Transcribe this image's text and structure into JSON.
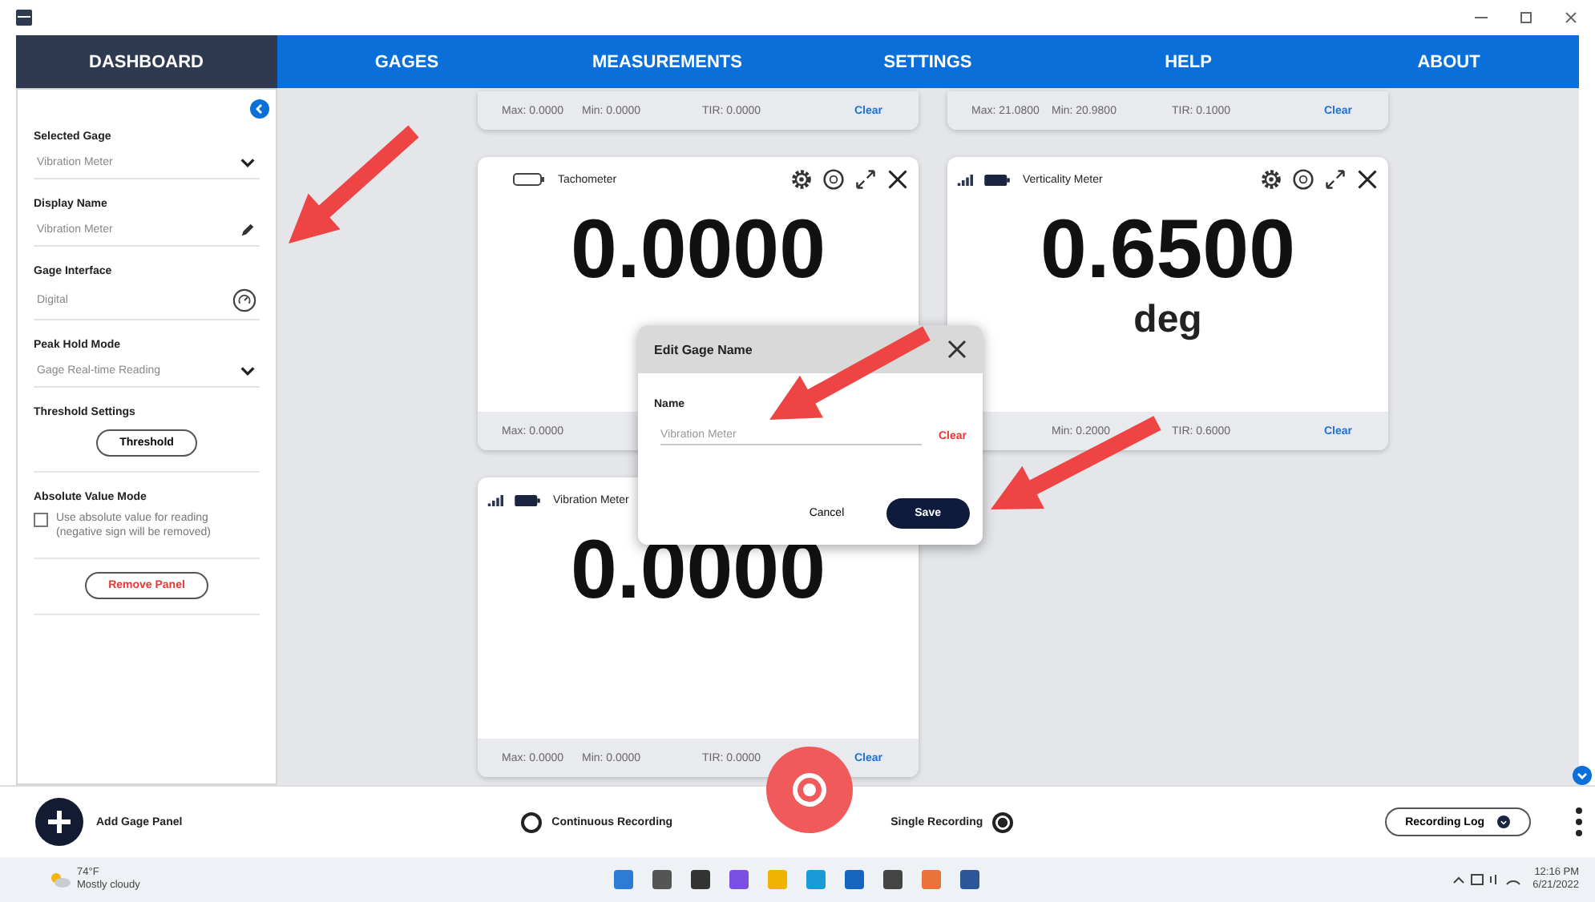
{
  "nav_tabs": [
    {
      "label": "DASHBOARD",
      "selected": true
    },
    {
      "label": "GAGES",
      "selected": false
    },
    {
      "label": "MEASUREMENTS",
      "selected": false
    },
    {
      "label": "SETTINGS",
      "selected": false
    },
    {
      "label": "HELP",
      "selected": false
    },
    {
      "label": "ABOUT",
      "selected": false
    }
  ],
  "sidebar": {
    "fields": [
      {
        "label": "Selected Gage",
        "value": "Vibration Meter",
        "kind": "dropdown"
      },
      {
        "label": "Display Name",
        "value": "Vibration Meter",
        "kind": "edit"
      },
      {
        "label": "Gage Interface",
        "value": "Digital",
        "kind": "interface"
      },
      {
        "label": "Peak Hold Mode",
        "value": "Gage Real-time Reading",
        "kind": "dropdown"
      }
    ],
    "threshold": {
      "label": "Threshold Settings",
      "button": "Threshold"
    },
    "absolute": {
      "label": "Absolute Value Mode",
      "checked": false,
      "text": "Use absolute value for reading (negative sign will be removed)"
    },
    "remove_button": "Remove Panel"
  },
  "top_cards": [
    {
      "footer": {
        "max": "Max: 0.0000",
        "min": "Min: 0.0000",
        "tir": "TIR: 0.0000",
        "clear": "Clear"
      }
    },
    {
      "footer": {
        "max": "Max: 21.0800",
        "min": "Min: 20.9800",
        "tir": "TIR: 0.1000",
        "clear": "Clear"
      }
    }
  ],
  "cards": [
    {
      "name": "Tachometer",
      "connected": false,
      "toolbar": true,
      "value": "0.0000",
      "footer": {
        "max": "Max: 0.0000"
      }
    },
    {
      "name": "Verticality Meter",
      "connected": true,
      "toolbar": true,
      "value": "0.6500",
      "unit": "deg",
      "footer": {
        "min": "Min: 0.2000",
        "tir": "TIR: 0.6000",
        "clear": "Clear"
      }
    },
    {
      "name": "Vibration Meter",
      "connected": true,
      "value": "0.0000",
      "footer": {
        "max": "Max: 0.0000",
        "min": "Min: 0.0000",
        "tir": "TIR: 0.0000",
        "clear": "Clear"
      }
    }
  ],
  "dialog": {
    "title": "Edit Gage Name",
    "label": "Name",
    "placeholder": "Vibration Meter",
    "clear": "Clear",
    "cancel": "Cancel",
    "save": "Save"
  },
  "bottom_bar": {
    "add_label": "Add Gage Panel",
    "modes": [
      {
        "label": "Continuous Recording",
        "selected": false
      },
      {
        "label": "Single Recording",
        "selected": true
      }
    ],
    "log_button": "Recording Log"
  },
  "taskbar": {
    "temperature": "74°F",
    "weather": "Mostly cloudy",
    "time": "12:16 PM",
    "date": "6/21/2022"
  }
}
